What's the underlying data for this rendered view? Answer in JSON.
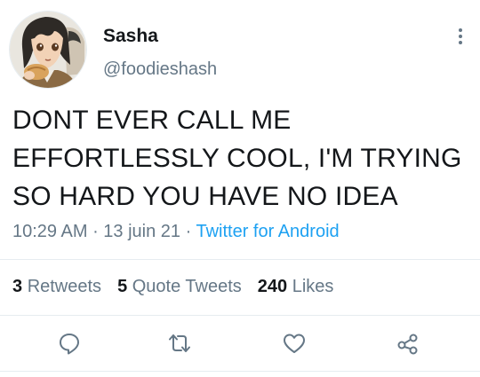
{
  "author": {
    "name": "Sasha",
    "handle": "@foodieshash"
  },
  "tweet": {
    "text_lines": [
      "DONT EVER CALL ME",
      "EFFORTLESSLY COOL, I'M TRYING",
      "SO HARD YOU HAVE NO IDEA"
    ]
  },
  "meta": {
    "time": "10:29 AM",
    "separator1": " · ",
    "date": "13 juin 21",
    "separator2": " · ",
    "source": "Twitter for Android"
  },
  "stats": {
    "retweets_count": "3",
    "retweets_label": "Retweets",
    "quotes_count": "5",
    "quotes_label": "Quote Tweets",
    "likes_count": "240",
    "likes_label": "Likes"
  },
  "icons": {
    "more": "more-vertical-icon",
    "reply": "reply-icon",
    "retweet": "retweet-icon",
    "like": "heart-icon",
    "share": "share-icon"
  },
  "colors": {
    "text": "#14171a",
    "secondary": "#657786",
    "link": "#1da1f2",
    "divider": "#e6ecf0"
  }
}
